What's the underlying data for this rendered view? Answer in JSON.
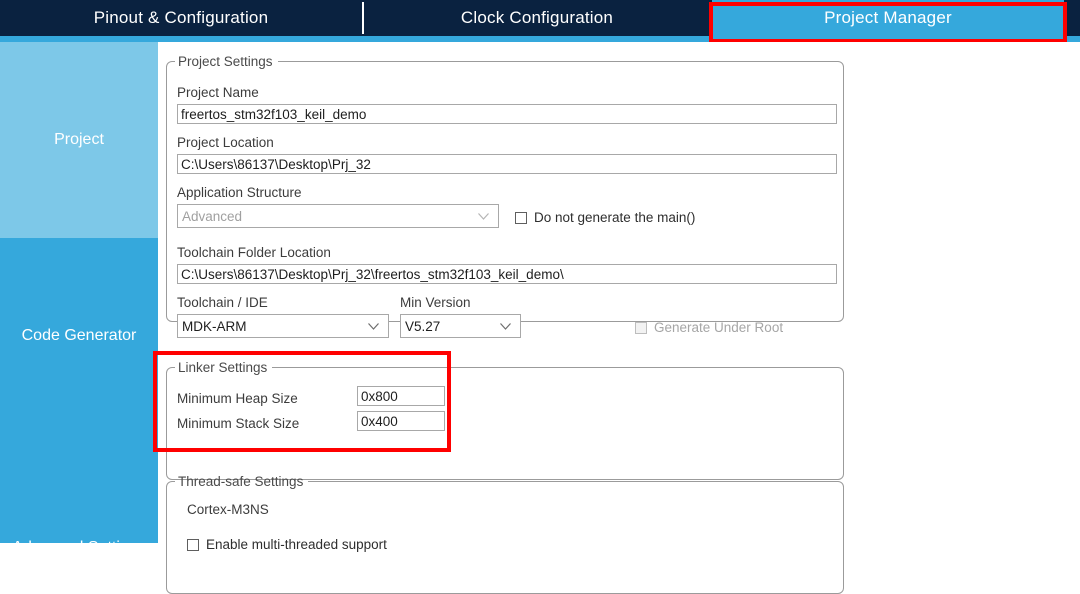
{
  "tabs": [
    {
      "label": "Pinout & Configuration",
      "active": false
    },
    {
      "label": "Clock Configuration",
      "active": false
    },
    {
      "label": "Project Manager",
      "active": true
    }
  ],
  "sidebar": {
    "items": [
      {
        "label": "Project"
      },
      {
        "label": "Code Generator"
      },
      {
        "label": "Advanced Settings"
      }
    ]
  },
  "project_settings": {
    "legend": "Project Settings",
    "project_name_label": "Project Name",
    "project_name_value": "freertos_stm32f103_keil_demo",
    "project_location_label": "Project Location",
    "project_location_value": "C:\\Users\\86137\\Desktop\\Prj_32",
    "application_structure_label": "Application Structure",
    "application_structure_value": "Advanced",
    "do_not_generate_main_label": "Do not generate the main()",
    "toolchain_folder_label": "Toolchain Folder Location",
    "toolchain_folder_value": "C:\\Users\\86137\\Desktop\\Prj_32\\freertos_stm32f103_keil_demo\\",
    "toolchain_ide_label": "Toolchain / IDE",
    "toolchain_ide_value": "MDK-ARM",
    "min_version_label": "Min Version",
    "min_version_value": "V5.27",
    "generate_under_root_label": "Generate Under Root"
  },
  "linker_settings": {
    "legend": "Linker Settings",
    "min_heap_label": "Minimum Heap Size",
    "min_heap_value": "0x800",
    "min_stack_label": "Minimum Stack Size",
    "min_stack_value": "0x400"
  },
  "thread_safe_settings": {
    "legend": "Thread-safe Settings",
    "core_label": "Cortex-M3NS",
    "enable_multithread_label": "Enable multi-threaded support"
  },
  "annotations": {
    "highlight_color": "#ff0000",
    "active_tab_color": "#35a8dc",
    "tabbar_color": "#0a2240",
    "sidebar_selected_color": "#7dc8e8",
    "sidebar_color": "#35a8dc"
  }
}
